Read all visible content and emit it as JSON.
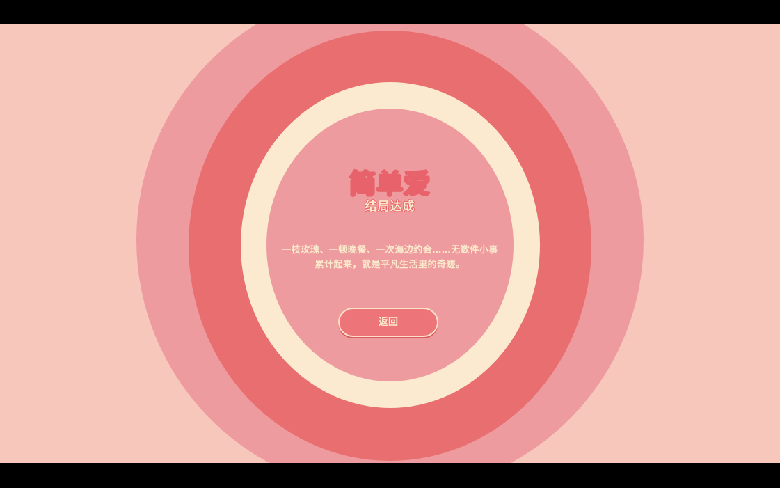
{
  "ending": {
    "title": "简单爱",
    "subtitle": "结局达成",
    "description": "一枝玫瑰、一顿晚餐、一次海边约会……无数件小事累计起来，就是平凡生活里的奇迹。"
  },
  "buttons": {
    "back_label": "返回"
  },
  "colors": {
    "background": "#f7c7bb",
    "ring_outer": "#ee9b9f",
    "ring_mid": "#e96e70",
    "ring_cream": "#fbeacf",
    "text_cream": "#fbe9cc",
    "accent_red": "#e7626a"
  }
}
